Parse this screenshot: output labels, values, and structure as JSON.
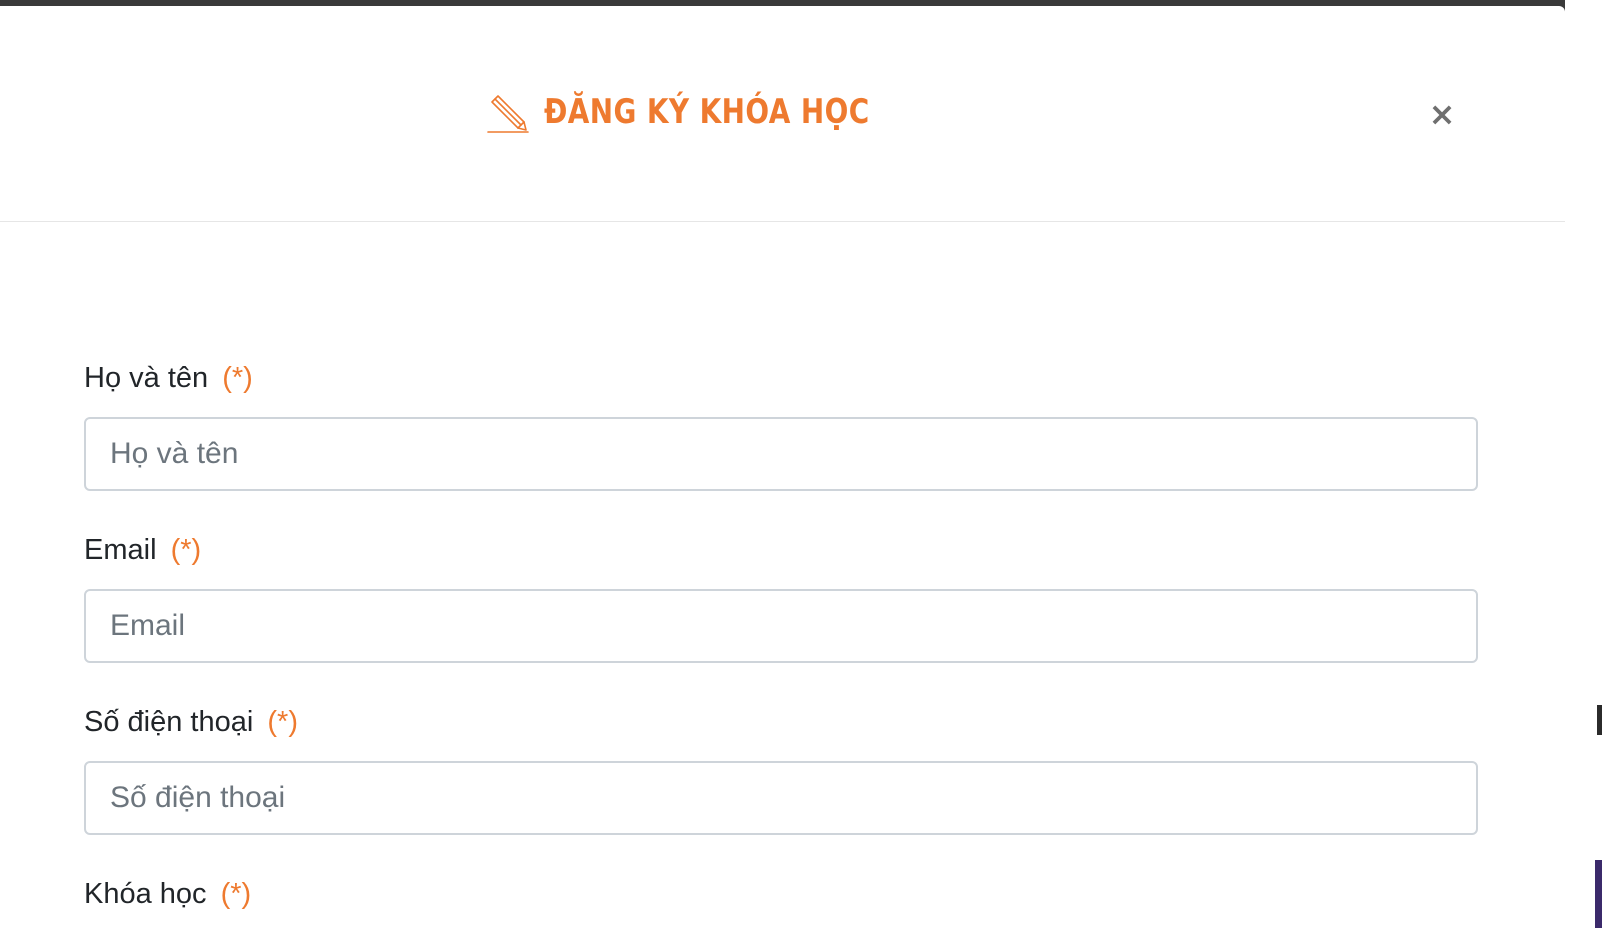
{
  "colors": {
    "accent": "#ee7a2f",
    "label_text": "#212529",
    "placeholder": "#6c757d",
    "border": "#ced4da",
    "close": "#6f6f6f"
  },
  "modal": {
    "title": "ĐĂNG KÝ KHÓA HỌC",
    "title_icon": "pencil-icon",
    "close_label": "×"
  },
  "form": {
    "required_marker": "(*)",
    "fields": [
      {
        "label": "Họ và tên",
        "placeholder": "Họ và tên",
        "value": ""
      },
      {
        "label": "Email",
        "placeholder": "Email",
        "value": ""
      },
      {
        "label": "Số điện thoại",
        "placeholder": "Số điện thoại",
        "value": ""
      },
      {
        "label": "Khóa học"
      }
    ]
  }
}
